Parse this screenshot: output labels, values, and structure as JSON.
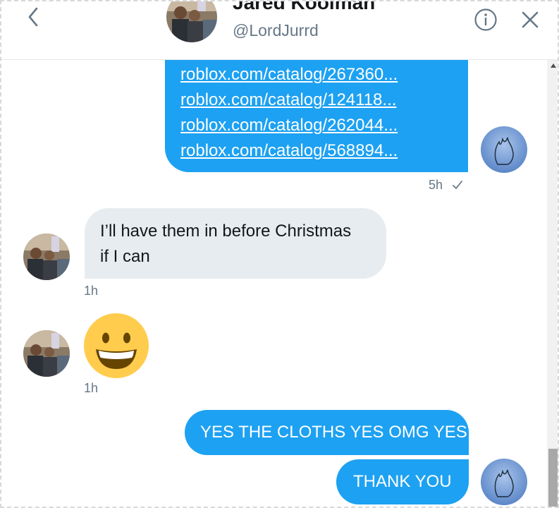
{
  "header": {
    "name": "Jared Kooiman",
    "handle": "@LordJurrd"
  },
  "icons": {
    "back": "chevron-left-icon",
    "info": "info-circle-icon",
    "close": "close-icon",
    "read_receipt": "check-icon",
    "emoji": "grinning-face-emoji"
  },
  "colors": {
    "outgoing_bubble": "#1da1f2",
    "incoming_bubble": "#e6ecf0",
    "timestamp": "#657786"
  },
  "messages": {
    "links": {
      "items": [
        "roblox.com/catalog/267360...",
        "roblox.com/catalog/124118...",
        "roblox.com/catalog/262044...",
        "roblox.com/catalog/568894..."
      ],
      "time": "5h"
    },
    "reply1": {
      "line1": "I’ll have them in before Christmas",
      "line2": "if I can",
      "time": "1h"
    },
    "emoji_msg": {
      "time": "1h"
    },
    "out1": {
      "text": "YES THE CLOTHS YES OMG YES"
    },
    "out2": {
      "text": "THANK YOU"
    }
  }
}
